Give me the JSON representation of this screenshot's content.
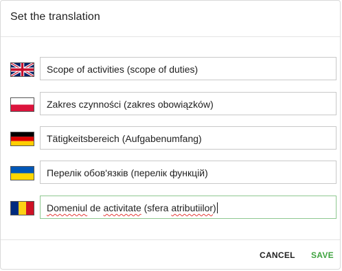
{
  "dialog": {
    "title": "Set the translation",
    "cancel_label": "CANCEL",
    "save_label": "SAVE"
  },
  "translations": [
    {
      "flag": "uk-flag-icon",
      "value": "Scope of activities (scope of duties)"
    },
    {
      "flag": "poland-flag-icon",
      "value": "Zakres czynności (zakres obowiązków)"
    },
    {
      "flag": "germany-flag-icon",
      "value": "Tätigkeitsbereich (Aufgabenumfang)"
    },
    {
      "flag": "ukraine-flag-icon",
      "value": "Перелік обов'язків (перелік функцій)"
    },
    {
      "flag": "romania-flag-icon",
      "value": "Domeniul de activitate (sfera atributiilor)"
    }
  ],
  "romanian_segments": {
    "w1": "Domeniul",
    "s1": " de ",
    "w2": "activitate",
    "s2": " (sfera ",
    "w3": "atributiilor",
    "s3": ")"
  },
  "colors": {
    "save_accent": "#3ea33f",
    "focused_border": "#8dc78f",
    "spellcheck": "#e53935"
  }
}
